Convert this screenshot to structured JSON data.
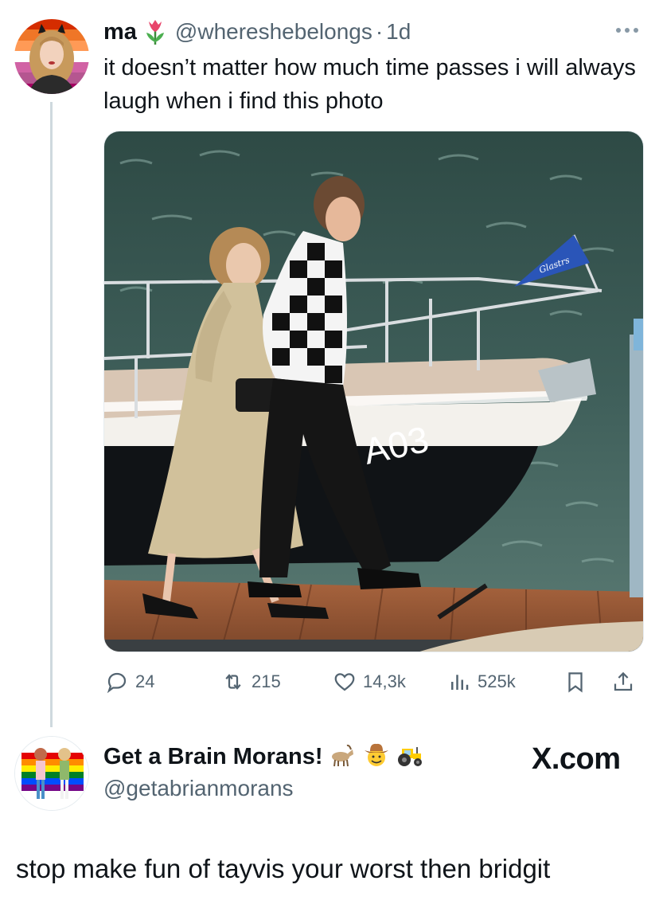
{
  "tweet": {
    "author_name": "ma",
    "handle": "@whereshebelongs",
    "separator": "·",
    "time": "1d",
    "text": "it doesn’t matter how much time passes i will always laugh when i find this photo",
    "stats": {
      "replies": "24",
      "retweets": "215",
      "likes": "14,3k",
      "views": "525k"
    }
  },
  "reply": {
    "author_name": "Get a Brain Morans!",
    "handle": "@getabrianmorans",
    "text": "stop make fun of tayvis your worst then bridgit"
  },
  "watermark": "X.com",
  "photo": {
    "boat_number": "A03",
    "flag_text": "Glastrs"
  },
  "icons": {
    "author_flair": "tulip-icon",
    "reply_name_flair": [
      "goat-icon",
      "cowboy-face-icon",
      "tractor-icon"
    ]
  },
  "colors": {
    "text": "#0f1419",
    "muted": "#536471",
    "thread_line": "#cfd9de",
    "flag_stripes": [
      "#d52d00",
      "#ef7627",
      "#ff9a56",
      "#ffffff",
      "#d162a4",
      "#b55690",
      "#a30262"
    ]
  }
}
